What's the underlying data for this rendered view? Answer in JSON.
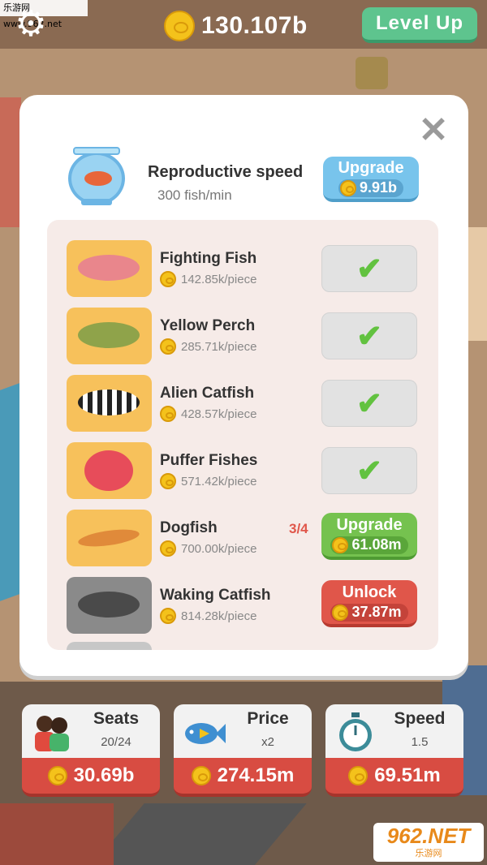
{
  "watermark": "乐游网 www.962.net",
  "logo": {
    "line1": "962.NET",
    "line2": "乐游网"
  },
  "topbar": {
    "money": "130.107b",
    "level_up_label": "Level Up"
  },
  "modal": {
    "close_icon": "close-icon",
    "header": {
      "title": "Reproductive speed",
      "subtitle": "300 fish/min",
      "upgrade_label": "Upgrade",
      "upgrade_cost": "9.91b"
    },
    "fish": [
      {
        "name": "Fighting Fish",
        "price": "142.85k/piece",
        "status": "owned",
        "color": "#e9868c"
      },
      {
        "name": "Yellow Perch",
        "price": "285.71k/piece",
        "status": "owned",
        "color": "#8fa34a"
      },
      {
        "name": "Alien Catfish",
        "price": "428.57k/piece",
        "status": "owned",
        "color": "#3a3a3a"
      },
      {
        "name": "Puffer Fishes",
        "price": "571.42k/piece",
        "status": "owned",
        "color": "#e74c5a"
      },
      {
        "name": "Dogfish",
        "price": "700.00k/piece",
        "status": "upgrade",
        "progress": "3/4",
        "button_label": "Upgrade",
        "button_cost": "61.08m",
        "color": "#e08a3a"
      },
      {
        "name": "Waking Catfish",
        "price": "814.28k/piece",
        "status": "locked",
        "button_label": "Unlock",
        "button_cost": "37.87m",
        "color": "#4a4a4a"
      }
    ]
  },
  "cards": [
    {
      "title": "Seats",
      "value": "20/24",
      "cost": "30.69b",
      "icon": "people-icon"
    },
    {
      "title": "Price",
      "value": "x2",
      "cost": "274.15m",
      "icon": "fish-icon"
    },
    {
      "title": "Speed",
      "value": "1.5",
      "cost": "69.51m",
      "icon": "stopwatch-icon"
    }
  ],
  "colors": {
    "accent_green": "#5ec48e",
    "upgrade_green": "#75c24f",
    "unlock_red": "#e0564a",
    "upgrade_blue": "#78c4ec",
    "coin_gold": "#f4c21b"
  }
}
